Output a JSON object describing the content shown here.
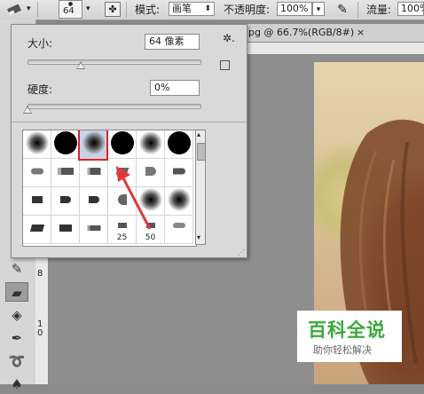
{
  "options_bar": {
    "brush_size": "64",
    "mode_label": "模式:",
    "mode_value": "画笔",
    "opacity_label": "不透明度:",
    "opacity_value": "100%",
    "flow_label": "流量:",
    "flow_value": "100%"
  },
  "document": {
    "tab_title": "pg @ 66.7%(RGB/8#)",
    "close_glyph": "×"
  },
  "ruler_left_marks": [
    "8",
    "1",
    "0"
  ],
  "brush_panel": {
    "size_label": "大小:",
    "size_value": "64 像素",
    "size_fraction": 0.31,
    "hardness_label": "硬度:",
    "hardness_value": "0%",
    "hardness_fraction": 0.0,
    "gear_glyph": "✲.",
    "preset_numbers": [
      "25",
      "50"
    ]
  },
  "watermark": {
    "title": "百科全说",
    "subtitle": "助你轻松解决"
  },
  "colors": {
    "highlight_box": "#e0202a",
    "arrow": "#e03a3a",
    "watermark_green": "#3aa83a"
  }
}
